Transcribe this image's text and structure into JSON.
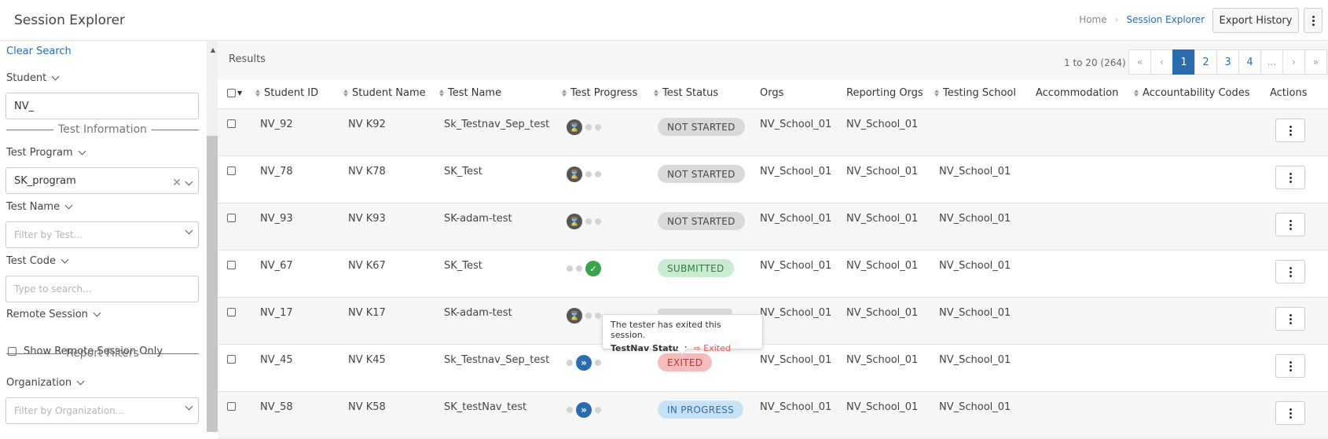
{
  "app": {
    "title": "Session Explorer"
  },
  "breadcrumb": {
    "home": "Home",
    "current": "Session Explorer"
  },
  "header": {
    "export_label": "Export History"
  },
  "sidebar": {
    "clear_search": "Clear Search",
    "student": {
      "label": "Student",
      "value": "NV_"
    },
    "test_info_header": "Test Information",
    "test_program": {
      "label": "Test Program",
      "value": "SK_program"
    },
    "test_name": {
      "label": "Test Name",
      "placeholder": "Filter by Test..."
    },
    "test_code": {
      "label": "Test Code",
      "placeholder": "Type to search..."
    },
    "remote_session": {
      "label": "Remote Session",
      "checkbox_label": "Show Remote Session Only"
    },
    "report_filters_header": "Report Filters",
    "organization": {
      "label": "Organization",
      "placeholder": "Filter by Organization..."
    }
  },
  "results": {
    "label": "Results",
    "count": "1 to 20 (264)",
    "pager": [
      "«",
      "‹",
      "1",
      "2",
      "3",
      "4",
      "...",
      "›",
      "»"
    ],
    "current_page": "1"
  },
  "table": {
    "columns": [
      "Student ID",
      "Student Name",
      "Test Name",
      "Test Progress",
      "Test Status",
      "Orgs",
      "Reporting Orgs",
      "Testing School",
      "Accommodation",
      "Accountability Codes",
      "Actions"
    ],
    "rows": [
      {
        "id": "NV_92",
        "name": "NV K92",
        "test": "Sk_Testnav_Sep_test",
        "progress": "not-started",
        "status": "NOT STARTED",
        "orgs": "NV_School_01",
        "reporting": "NV_School_01",
        "school": ""
      },
      {
        "id": "NV_78",
        "name": "NV K78",
        "test": "SK_Test",
        "progress": "not-started",
        "status": "NOT STARTED",
        "orgs": "NV_School_01",
        "reporting": "NV_School_01",
        "school": "NV_School_01"
      },
      {
        "id": "NV_93",
        "name": "NV K93",
        "test": "SK-adam-test",
        "progress": "not-started",
        "status": "NOT STARTED",
        "orgs": "NV_School_01",
        "reporting": "NV_School_01",
        "school": "NV_School_01"
      },
      {
        "id": "NV_67",
        "name": "NV K67",
        "test": "SK_Test",
        "progress": "submitted",
        "status": "SUBMITTED",
        "orgs": "NV_School_01",
        "reporting": "NV_School_01",
        "school": "NV_School_01"
      },
      {
        "id": "NV_17",
        "name": "NV K17",
        "test": "SK-adam-test",
        "progress": "not-started",
        "status": "",
        "orgs": "NV_School_01",
        "reporting": "NV_School_01",
        "school": "NV_School_01"
      },
      {
        "id": "NV_45",
        "name": "NV K45",
        "test": "Sk_Testnav_Sep_test",
        "progress": "in-progress",
        "status": "EXITED",
        "orgs": "NV_School_01",
        "reporting": "NV_School_01",
        "school": "NV_School_01"
      },
      {
        "id": "NV_58",
        "name": "NV K58",
        "test": "SK_testNav_test",
        "progress": "in-progress",
        "status": "IN PROGRESS",
        "orgs": "NV_School_01",
        "reporting": "NV_School_01",
        "school": "NV_School_01"
      }
    ]
  },
  "tooltip": {
    "message": "The tester has exited this session.",
    "status_label": "TestNav Status:",
    "status_value": "Exited"
  }
}
